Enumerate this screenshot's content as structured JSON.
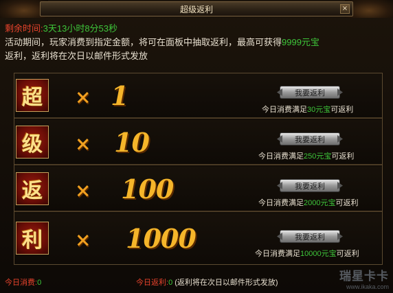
{
  "window": {
    "title": "超级返利",
    "close_label": "×"
  },
  "countdown": {
    "label": "剩余时间:",
    "value": "3天13小时8分53秒"
  },
  "description": {
    "line1_before": "活动期间，玩家消费到指定金额，将可在面板中抽取返利，最高可获得",
    "line1_highlight": "9999元宝",
    "line2": "返利，返利将在次日以邮件形式发放"
  },
  "rows": [
    {
      "char": "超",
      "times_symbol": "×",
      "multiplier": "1",
      "button": "我要返利",
      "cond_prefix": "今日消费满足",
      "cond_amount": "30元宝",
      "cond_suffix": "可返利"
    },
    {
      "char": "级",
      "times_symbol": "×",
      "multiplier": "10",
      "button": "我要返利",
      "cond_prefix": "今日消费满足",
      "cond_amount": "250元宝",
      "cond_suffix": "可返利"
    },
    {
      "char": "返",
      "times_symbol": "×",
      "multiplier": "100",
      "button": "我要返利",
      "cond_prefix": "今日消费满足",
      "cond_amount": "2000元宝",
      "cond_suffix": "可返利"
    },
    {
      "char": "利",
      "times_symbol": "×",
      "multiplier": "1000",
      "button": "我要返利",
      "cond_prefix": "今日消费满足",
      "cond_amount": "10000元宝",
      "cond_suffix": "可返利"
    }
  ],
  "footer": {
    "spend_label": "今日消费:",
    "spend_value": "0",
    "rebate_label": "今日返利:",
    "rebate_value": "0",
    "note": "(返利将在次日以邮件形式发放)"
  },
  "watermark": {
    "brand": "瑞星卡卡",
    "url": "www.ikaka.com"
  },
  "colors": {
    "accent_red": "#e8432c",
    "accent_green": "#3ec63a",
    "gold": "#f5b52a"
  }
}
